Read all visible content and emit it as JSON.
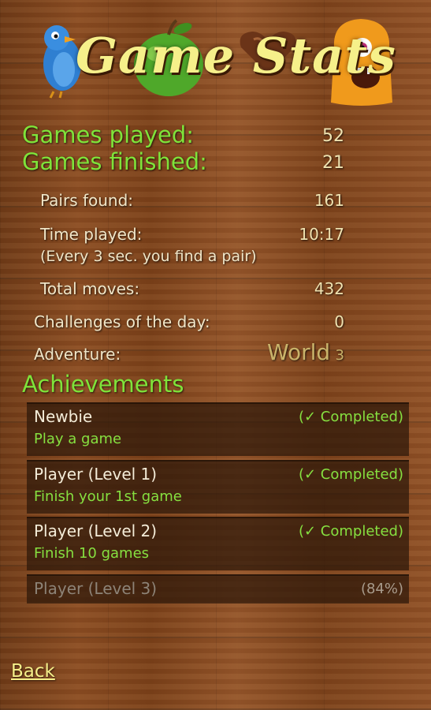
{
  "header": {
    "title": "Game Stats",
    "icons": [
      "bird-icon",
      "apple-icon",
      "chocolate-icon",
      "monster-icon"
    ]
  },
  "stats": {
    "games_played_label": "Games played:",
    "games_played_value": "52",
    "games_finished_label": "Games finished:",
    "games_finished_value": "21",
    "pairs_found_label": "Pairs found:",
    "pairs_found_value": "161",
    "time_played_label": "Time played:",
    "time_played_value": "10:17",
    "time_played_note": "(Every 3 sec. you find a pair)",
    "total_moves_label": "Total moves:",
    "total_moves_value": "432",
    "challenges_label": "Challenges of the day:",
    "challenges_value": "0",
    "adventure_label": "Adventure:",
    "adventure_world": "World",
    "adventure_number": "3"
  },
  "achievements": {
    "title": "Achievements",
    "items": [
      {
        "name": "Newbie",
        "status": "(✓ Completed)",
        "description": "Play a game"
      },
      {
        "name": "Player (Level 1)",
        "status": "(✓ Completed)",
        "description": "Finish your 1st game"
      },
      {
        "name": "Player (Level 2)",
        "status": "(✓ Completed)",
        "description": "Finish 10 games"
      },
      {
        "name": "Player (Level 3)",
        "status": "(84%)",
        "progress": 0.84
      }
    ]
  },
  "footer": {
    "back_label": "Back"
  },
  "colors": {
    "title": "#f6f08a",
    "accent_green": "#7fe33a",
    "value_text": "#efe2b0",
    "wood": "#8a4c22"
  }
}
